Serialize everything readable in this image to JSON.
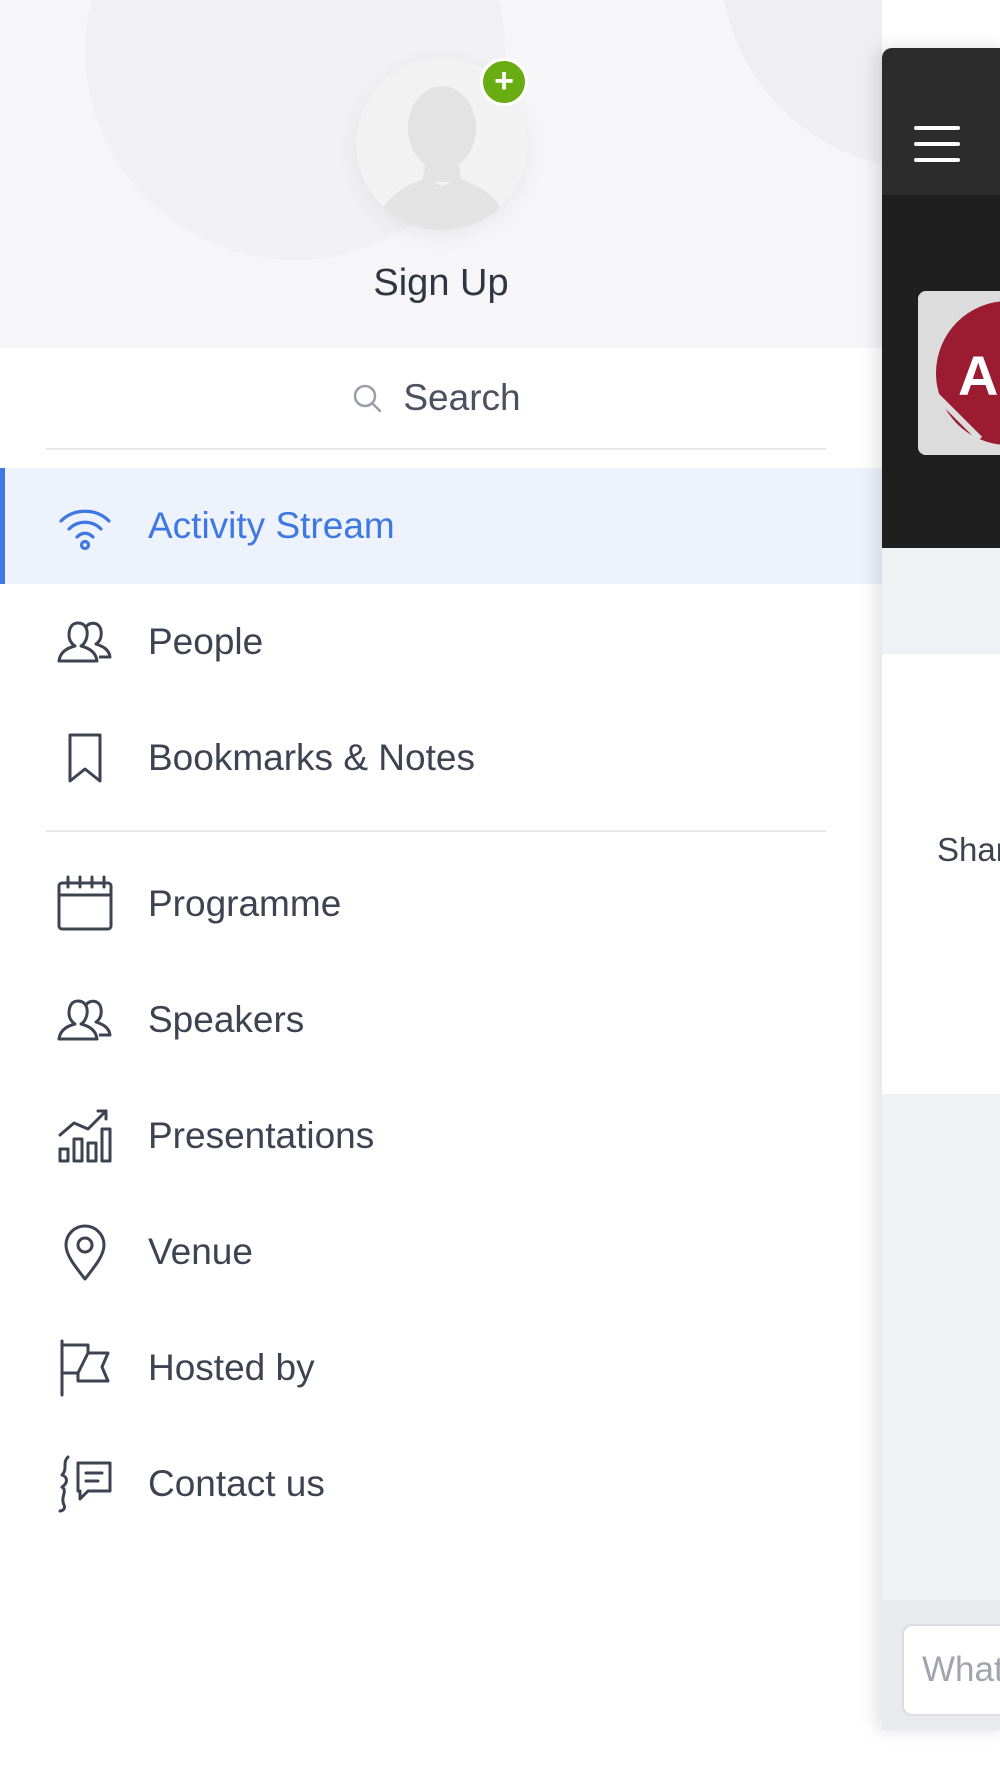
{
  "profile": {
    "signup_label": "Sign Up",
    "add_badge": "+"
  },
  "search": {
    "placeholder": "Search"
  },
  "menu": {
    "primary": [
      {
        "label": "Activity Stream",
        "icon": "wifi-icon",
        "active": true
      },
      {
        "label": "People",
        "icon": "people-icon",
        "active": false
      },
      {
        "label": "Bookmarks & Notes",
        "icon": "bookmark-icon",
        "active": false
      }
    ],
    "secondary": [
      {
        "label": "Programme",
        "icon": "calendar-icon"
      },
      {
        "label": "Speakers",
        "icon": "speakers-icon"
      },
      {
        "label": "Presentations",
        "icon": "chart-bars-icon"
      },
      {
        "label": "Venue",
        "icon": "location-pin-icon"
      },
      {
        "label": "Hosted by",
        "icon": "flag-icon"
      },
      {
        "label": "Contact us",
        "icon": "contact-chat-icon"
      }
    ]
  },
  "app_panel": {
    "logo_letter": "A",
    "share_text": "Shar",
    "post_placeholder": "What"
  },
  "colors": {
    "accent": "#3e78e3",
    "badge_green": "#6aad12",
    "logo_red": "#9b1b30",
    "topbar_dark": "#2c2c2c"
  }
}
